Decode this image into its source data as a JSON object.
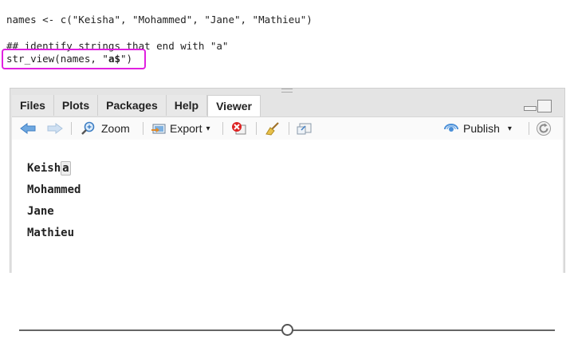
{
  "code": {
    "line1": "names <- c(\"Keisha\", \"Mohammed\", \"Jane\", \"Mathieu\")",
    "line2": "## identify strings that end with \"a\"",
    "line3_prefix": "str_view(names, \"",
    "line3_pattern": "a$",
    "line3_suffix": "\")"
  },
  "pane": {
    "tabs": [
      {
        "label": "Files"
      },
      {
        "label": "Plots"
      },
      {
        "label": "Packages"
      },
      {
        "label": "Help"
      },
      {
        "label": "Viewer",
        "active": true
      }
    ],
    "toolbar": {
      "zoom_label": "Zoom",
      "export_label": "Export",
      "publish_label": "Publish"
    },
    "viewer": {
      "lines": [
        {
          "prefix": "Keish",
          "match": "a"
        },
        {
          "prefix": "Mohammed",
          "match": ""
        },
        {
          "prefix": "Jane",
          "match": ""
        },
        {
          "prefix": "Mathieu",
          "match": ""
        }
      ]
    }
  },
  "slider": {
    "value_fraction": 0.5
  },
  "colors": {
    "highlight": "#e020e0",
    "accent_blue": "#4a8fd8"
  }
}
